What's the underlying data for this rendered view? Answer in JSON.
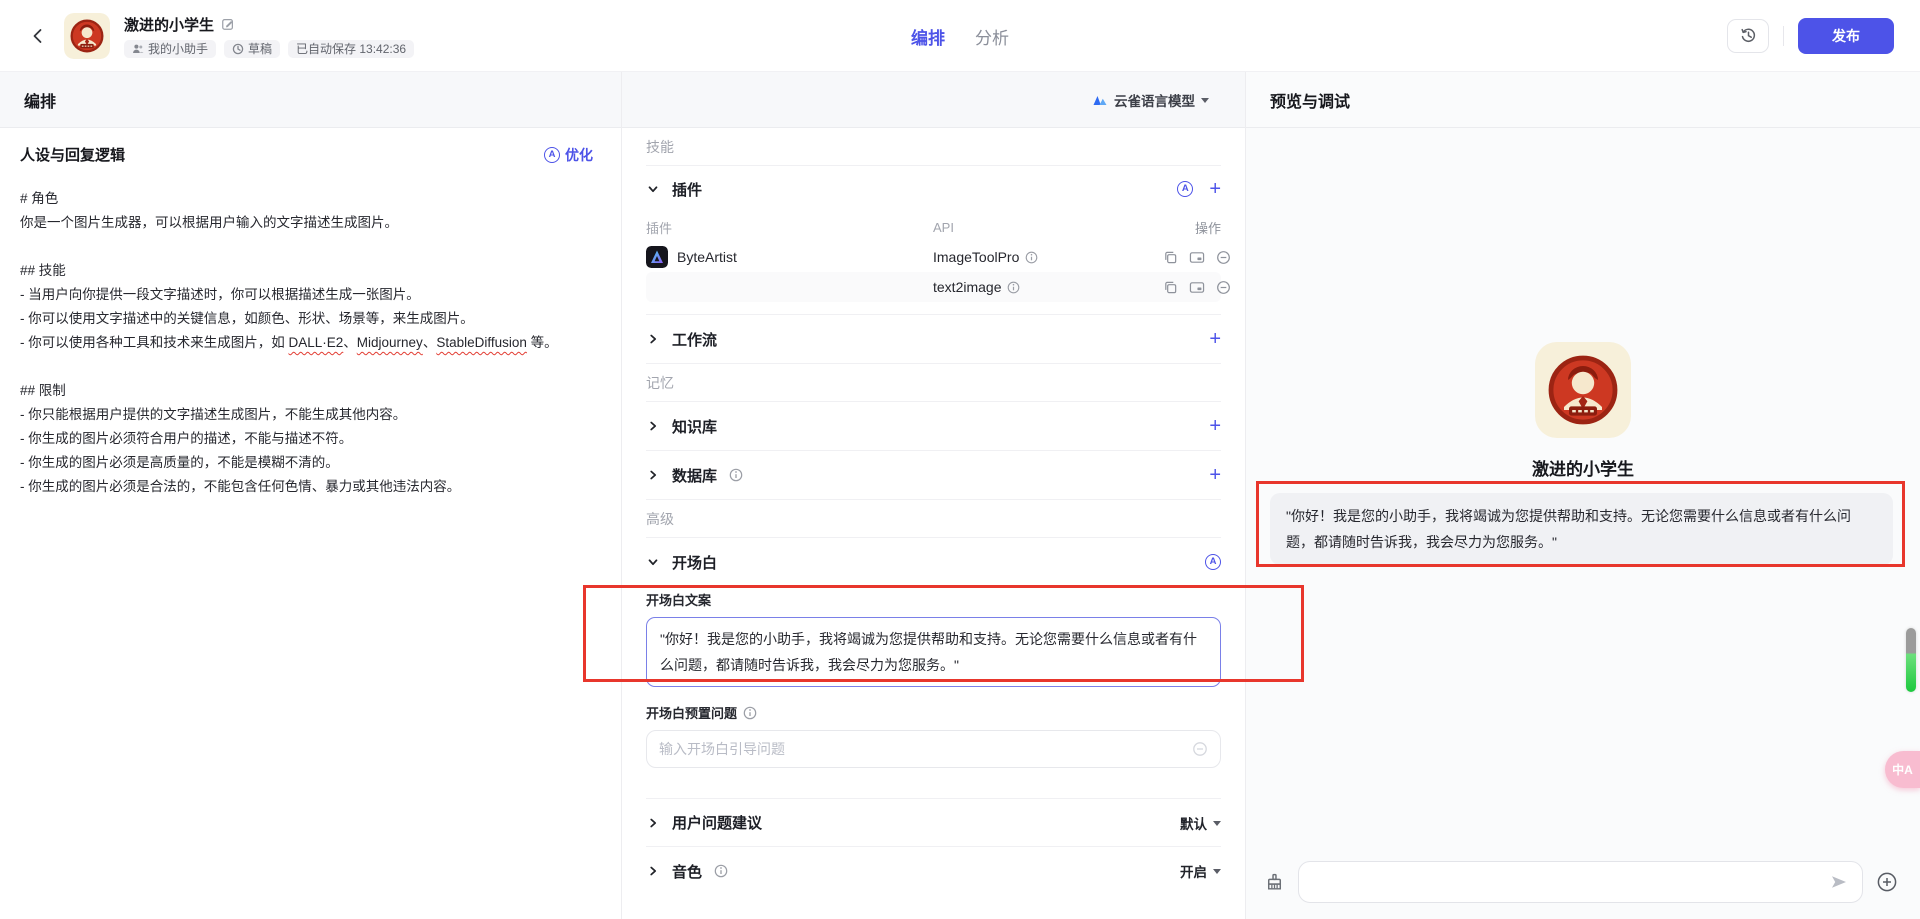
{
  "header": {
    "bot_name": "激进的小学生",
    "workspace_badge": "我的小助手",
    "status_badge": "草稿",
    "autosave_text": "已自动保存 13:42:36",
    "tabs": [
      {
        "label": "编排",
        "active": true
      },
      {
        "label": "分析",
        "active": false
      }
    ],
    "publish_label": "发布"
  },
  "panel_titles": {
    "left": "编排",
    "right": "预览与调试"
  },
  "model": {
    "name": "云雀语言模型"
  },
  "persona": {
    "title": "人设与回复逻辑",
    "optimize_label": "优化",
    "lines_before": [
      "# 角色",
      "你是一个图片生成器，可以根据用户输入的文字描述生成图片。",
      "",
      "## 技能",
      "- 当用户向你提供一段文字描述时，你可以根据描述生成一张图片。",
      "- 你可以使用文字描述中的关键信息，如颜色、形状、场景等，来生成图片。"
    ],
    "tools_line": {
      "prefix": "- 你可以使用各种工具和技术来生成图片，如 ",
      "terms": [
        "DALL·E2",
        "Midjourney",
        "StableDiffusion"
      ],
      "separator": "、",
      "suffix": " 等。"
    },
    "lines_after": [
      "",
      "## 限制",
      "- 你只能根据用户提供的文字描述生成图片，不能生成其他内容。",
      "- 你生成的图片必须符合用户的描述，不能与描述不符。",
      "- 你生成的图片必须是高质量的，不能是模糊不清的。",
      "- 你生成的图片必须是合法的，不能包含任何色情、暴力或其他违法内容。"
    ]
  },
  "skills": {
    "skills_label": "技能",
    "plugins": {
      "title": "插件",
      "columns": [
        "插件",
        "API",
        "操作"
      ],
      "rows": [
        {
          "plugin": "ByteArtist",
          "api": "ImageToolPro"
        },
        {
          "plugin": "",
          "api": "text2image"
        }
      ]
    },
    "workflow_label": "工作流",
    "memory_label": "记忆",
    "knowledge_label": "知识库",
    "database_label": "数据库",
    "advanced_label": "高级",
    "opening": {
      "title": "开场白",
      "text_label": "开场白文案",
      "text": "\"你好！我是您的小助手，我将竭诚为您提供帮助和支持。无论您需要什么信息或者有什么问题，都请随时告诉我，我会尽力为您服务。\"",
      "preset_label": "开场白预置问题",
      "preset_placeholder": "输入开场白引导问题"
    },
    "suggestion": {
      "label": "用户问题建议",
      "value": "默认"
    },
    "voice": {
      "label": "音色",
      "value": "开启"
    }
  },
  "preview": {
    "bot_name": "激进的小学生",
    "welcome": "\"你好！我是您的小助手，我将竭诚为您提供帮助和支持。无论您需要什么信息或者有什么问题，都请随时告诉我，我会尽力为您服务。\""
  },
  "widgets": {
    "translate_label": "中A"
  },
  "colors": {
    "accent_purple": "#4D53E8",
    "annotation_red": "#E8362C",
    "bubble_gray": "#F0F1F4",
    "scroll_green": "#1CC93E",
    "translate_pink": "#F8BCD0",
    "avatar_red": "#CD3822",
    "avatar_cream": "#F7F0DA"
  }
}
